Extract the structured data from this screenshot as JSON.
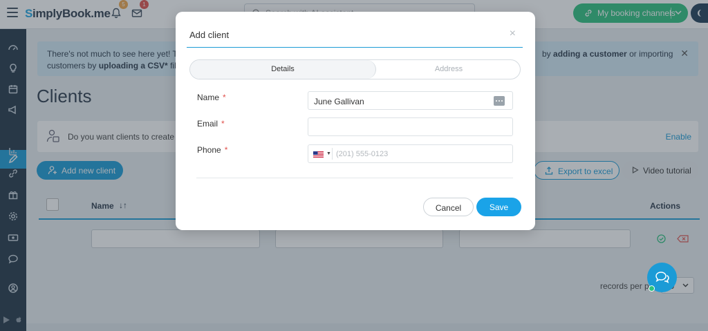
{
  "app": {
    "logo_text": "SimplyBook.me",
    "notifications_count": "5",
    "messages_count": "1",
    "search_placeholder": "Search with AI assistant",
    "booking_channels_label": "My booking channels"
  },
  "banner": {
    "text_start": "There's not much to see here yet! This",
    "text_right_pre": "by",
    "link_add_customer": "adding a customer",
    "text_right_post": "or importing",
    "line2_pre": "customers by",
    "link_upload_csv": "uploading a CSV*",
    "line2_post": "file c"
  },
  "page": {
    "title": "Clients",
    "info_text": "Do you want clients to create an",
    "enable_label": "Enable",
    "add_client_label": "Add new client",
    "export_label": "Export to excel",
    "video_label": "Video tutorial"
  },
  "table": {
    "columns": [
      "Name",
      "Actions"
    ],
    "sort_icon": "↓↑"
  },
  "pagination": {
    "records_label": "records per page",
    "records_value": "10"
  },
  "modal": {
    "title": "Add client",
    "close_glyph": "×",
    "tabs": [
      "Details",
      "Address"
    ],
    "fields": {
      "name_label": "Name",
      "name_value": "June Gallivan",
      "email_label": "Email",
      "email_value": "",
      "phone_label": "Phone",
      "phone_placeholder": "(201) 555-0123",
      "required_mark": "*"
    },
    "cancel_label": "Cancel",
    "save_label": "Save"
  },
  "colors": {
    "accent": "#1b9bd6",
    "success": "#2ec27e",
    "danger": "#e0514c",
    "sidebar": "#223546"
  }
}
